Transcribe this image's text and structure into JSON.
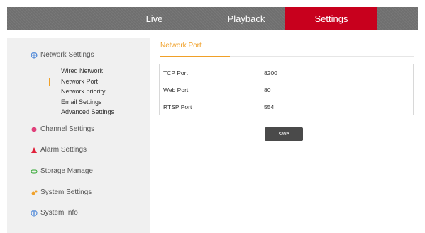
{
  "nav": {
    "tabs": [
      {
        "label": "Live"
      },
      {
        "label": "Playback"
      },
      {
        "label": "Settings"
      }
    ],
    "active_color": "#c8001d"
  },
  "sidebar": {
    "network_settings": {
      "label": "Network Settings",
      "icon": "network-icon",
      "children": [
        {
          "label": "Wired Network"
        },
        {
          "label": "Network Port"
        },
        {
          "label": "Network priority"
        },
        {
          "label": "Email Settings"
        },
        {
          "label": "Advanced Settings"
        }
      ]
    },
    "channel_settings": {
      "label": "Channel Settings",
      "icon": "channel-icon"
    },
    "alarm_settings": {
      "label": "Alarm Settings",
      "icon": "alarm-icon"
    },
    "storage_manage": {
      "label": "Storage Manage",
      "icon": "storage-icon"
    },
    "system_settings": {
      "label": "System Settings",
      "icon": "system-gear-icon"
    },
    "system_info": {
      "label": "System Info",
      "icon": "info-icon"
    }
  },
  "main": {
    "title": "Network Port",
    "accent_color": "#f0a028",
    "rows": [
      {
        "label": "TCP Port",
        "value": "8200"
      },
      {
        "label": "Web Port",
        "value": "80"
      },
      {
        "label": "RTSP Port",
        "value": "554"
      }
    ],
    "save_label": "save"
  }
}
